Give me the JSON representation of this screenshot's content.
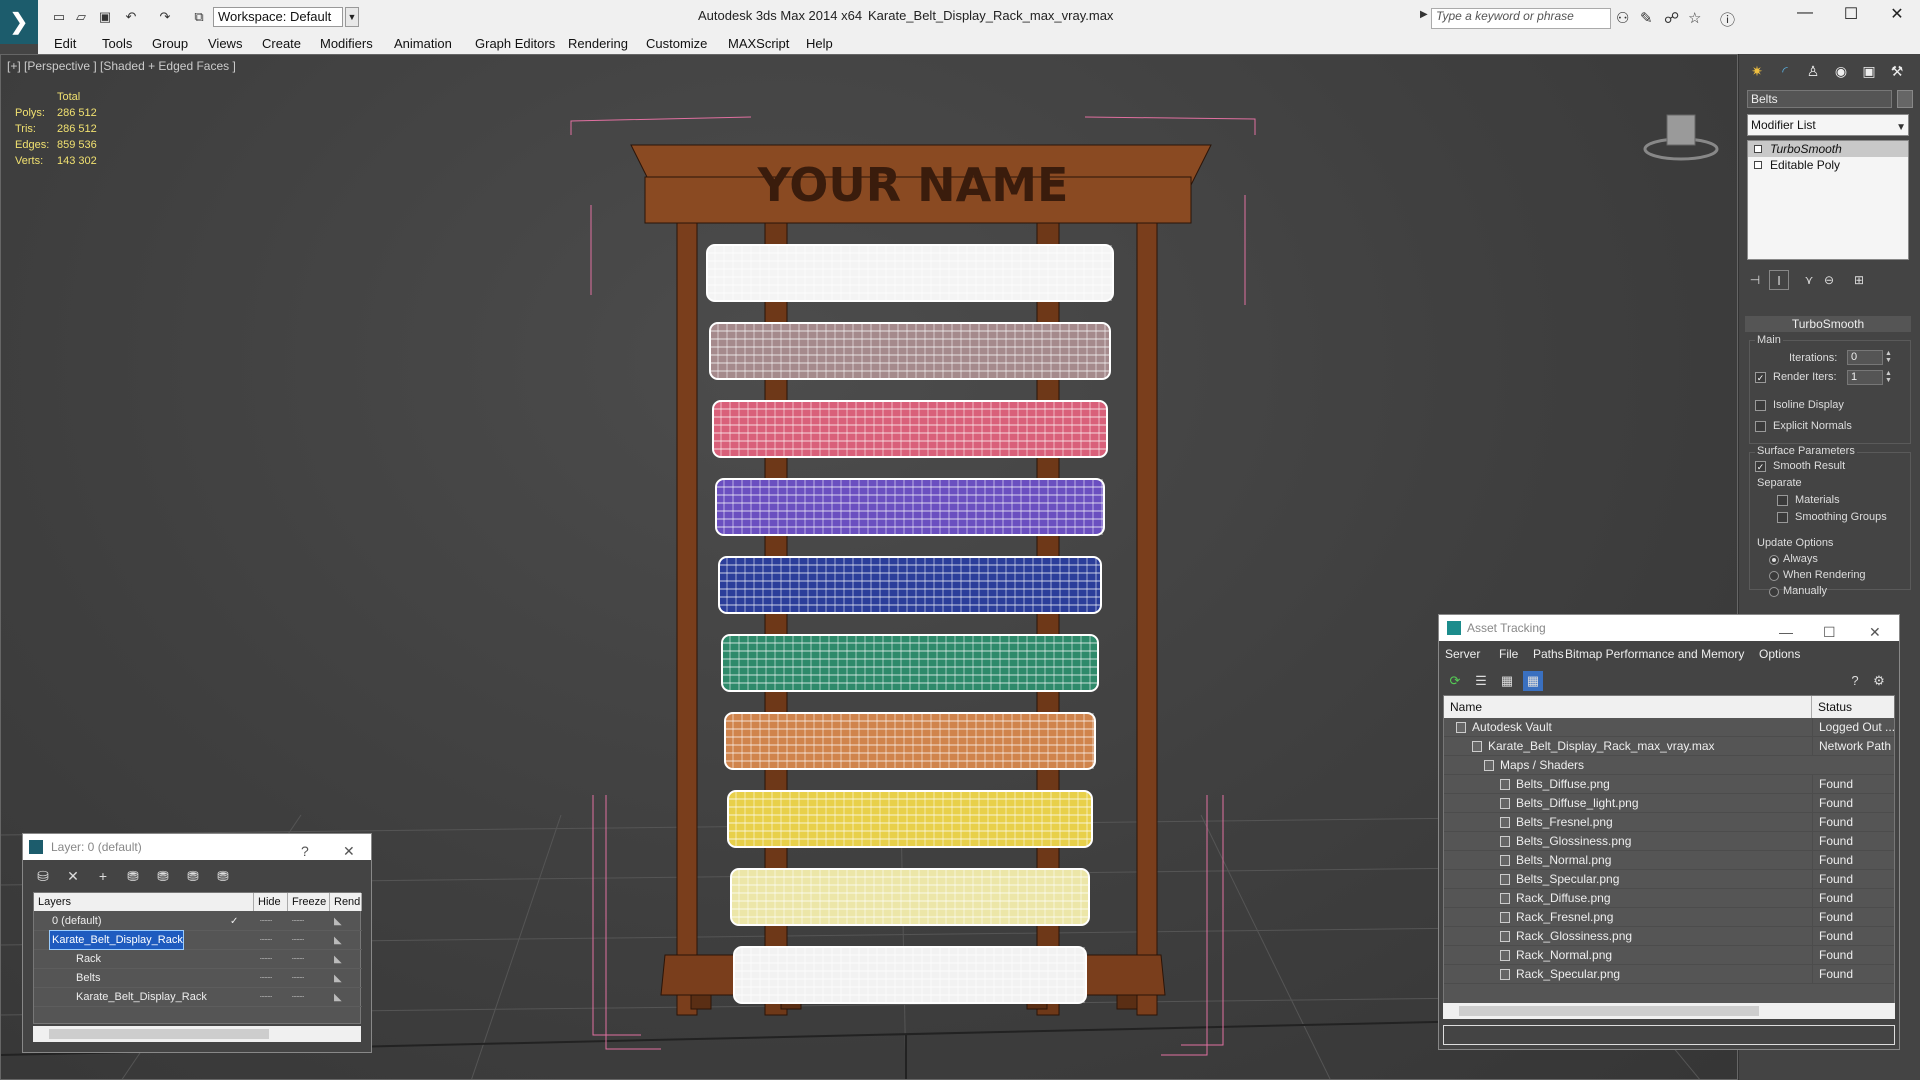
{
  "titlebar": {
    "workspace": "Workspace: Default",
    "app_title": "Autodesk 3ds Max  2014 x64",
    "file_title": "Karate_Belt_Display_Rack_max_vray.max",
    "search_placeholder": "Type a keyword or phrase"
  },
  "menu": [
    "Edit",
    "Tools",
    "Group",
    "Views",
    "Create",
    "Modifiers",
    "Animation",
    "Graph Editors",
    "Rendering",
    "Customize",
    "MAXScript",
    "Help"
  ],
  "viewport": {
    "label": "[+] [Perspective ] [Shaded + Edged Faces ]",
    "stats_header": "Total",
    "stats": [
      {
        "k": "Polys:",
        "v": "286 512"
      },
      {
        "k": "Tris:",
        "v": "286 512"
      },
      {
        "k": "Edges:",
        "v": "859 536"
      },
      {
        "k": "Verts:",
        "v": "143 302"
      }
    ],
    "sign_text": "YOUR NAME",
    "belt_colors": [
      "#f4f4f4",
      "#a58a8c",
      "#d9607a",
      "#6a4fc0",
      "#2b3e9a",
      "#2e8a6a",
      "#d0844c",
      "#e8d04a",
      "#ece6a8",
      "#f2f2f2"
    ],
    "wood_color": "#8a4a22"
  },
  "command_panel": {
    "object_name": "Belts",
    "modifier_list": "Modifier List",
    "stack": [
      "TurboSmooth",
      "Editable Poly"
    ],
    "rollout": "TurboSmooth",
    "main_label": "Main",
    "iterations_label": "Iterations:",
    "iterations": "0",
    "render_iters_label": "Render Iters:",
    "render_iters": "1",
    "isoline": "Isoline Display",
    "explicit": "Explicit Normals",
    "surface_label": "Surface Parameters",
    "smooth_result": "Smooth Result",
    "separate": "Separate",
    "materials": "Materials",
    "smoothing_groups": "Smoothing Groups",
    "update_label": "Update Options",
    "always": "Always",
    "when_rendering": "When Rendering",
    "manually": "Manually"
  },
  "layer_dialog": {
    "title": "Layer: 0 (default)",
    "help": "?",
    "headers": [
      "Layers",
      "Hide",
      "Freeze",
      "Rend"
    ],
    "rows": [
      {
        "name": "0 (default)",
        "indent": 16
      },
      {
        "name": "Karate_Belt_Display_Rack",
        "indent": 16
      },
      {
        "name": "Rack",
        "indent": 40
      },
      {
        "name": "Belts",
        "indent": 40
      },
      {
        "name": "Karate_Belt_Display_Rack",
        "indent": 40
      }
    ]
  },
  "asset_dialog": {
    "title": "Asset Tracking",
    "menu": [
      "Server",
      "File",
      "Paths",
      "Bitmap Performance and Memory",
      "Options"
    ],
    "headers": [
      "Name",
      "Status"
    ],
    "rows": [
      {
        "name": "Autodesk Vault",
        "status": "Logged Out ...",
        "indent": 28
      },
      {
        "name": "Karate_Belt_Display_Rack_max_vray.max",
        "status": "Network Path",
        "indent": 44
      },
      {
        "name": "Maps / Shaders",
        "status": "",
        "indent": 56
      },
      {
        "name": "Belts_Diffuse.png",
        "status": "Found",
        "indent": 72
      },
      {
        "name": "Belts_Diffuse_light.png",
        "status": "Found",
        "indent": 72
      },
      {
        "name": "Belts_Fresnel.png",
        "status": "Found",
        "indent": 72
      },
      {
        "name": "Belts_Glossiness.png",
        "status": "Found",
        "indent": 72
      },
      {
        "name": "Belts_Normal.png",
        "status": "Found",
        "indent": 72
      },
      {
        "name": "Belts_Specular.png",
        "status": "Found",
        "indent": 72
      },
      {
        "name": "Rack_Diffuse.png",
        "status": "Found",
        "indent": 72
      },
      {
        "name": "Rack_Fresnel.png",
        "status": "Found",
        "indent": 72
      },
      {
        "name": "Rack_Glossiness.png",
        "status": "Found",
        "indent": 72
      },
      {
        "name": "Rack_Normal.png",
        "status": "Found",
        "indent": 72
      },
      {
        "name": "Rack_Specular.png",
        "status": "Found",
        "indent": 72
      }
    ]
  }
}
